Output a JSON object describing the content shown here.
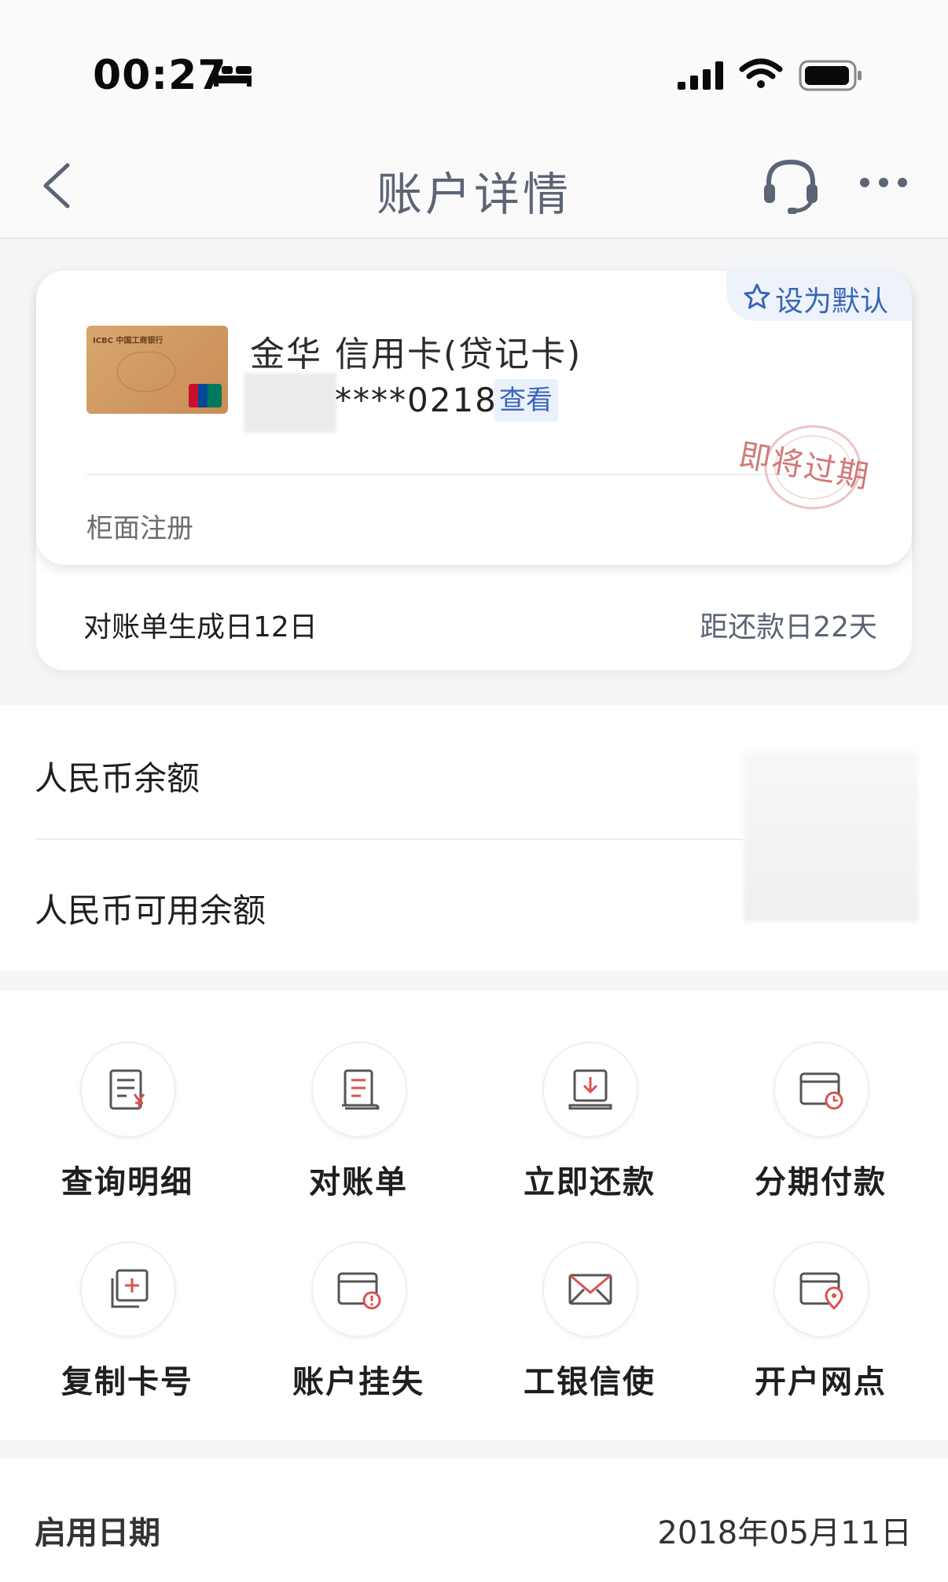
{
  "status_bar": {
    "time": "00:27"
  },
  "nav": {
    "title": "账户详情"
  },
  "card": {
    "set_default": "设为默认",
    "name": "金华 信用卡(贷记卡)",
    "number_masked": "****0218",
    "view_button": "查看",
    "registration": "柜面注册",
    "stamp": "即将过期",
    "bill_day": "对账单生成日12日",
    "due": "距还款日22天",
    "logo_text": "ICBC 中国工商银行"
  },
  "balance": {
    "rmb_balance_label": "人民币余额",
    "rmb_available_label": "人民币可用余额"
  },
  "actions": [
    {
      "label": "查询明细",
      "icon": "statement-yuan-icon"
    },
    {
      "label": "对账单",
      "icon": "bill-icon"
    },
    {
      "label": "立即还款",
      "icon": "repay-download-icon"
    },
    {
      "label": "分期付款",
      "icon": "installment-card-clock-icon"
    },
    {
      "label": "复制卡号",
      "icon": "copy-icon"
    },
    {
      "label": "账户挂失",
      "icon": "card-alert-icon"
    },
    {
      "label": "工银信使",
      "icon": "mail-icon"
    },
    {
      "label": "开户网点",
      "icon": "card-location-icon"
    }
  ],
  "details": {
    "start_date_label": "启用日期",
    "start_date_value": "2018年05月11日"
  },
  "colors": {
    "accent": "#3a66b8",
    "icon_red": "#d9534f",
    "title_gray": "#5c6476"
  }
}
